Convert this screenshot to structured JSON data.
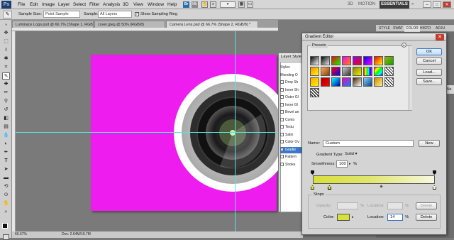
{
  "menu": {
    "logo": "Ps",
    "items": [
      "File",
      "Edit",
      "Image",
      "Layer",
      "Select",
      "Filter",
      "Analysis",
      "3D",
      "View",
      "Window",
      "Help"
    ],
    "workspaces": [
      "3D",
      "MOTION",
      "ESSENTIALS"
    ],
    "win_buttons": [
      "–",
      "□",
      "✕"
    ]
  },
  "options": {
    "sample_size_label": "Sample Size:",
    "sample_size_value": "Point Sample",
    "sample_label": "Sample:",
    "sample_value": "All Layers",
    "show_ring_label": "Show Sampling Ring",
    "show_ring_checked": true
  },
  "doc_tabs": [
    {
      "label": "Luminace Logo.psd @ 66.7% (Shape 1, RGB/8)",
      "active": false
    },
    {
      "label": "cover.jpeg @ 50% (RGB/8)",
      "active": false
    },
    {
      "label": "Camera Lens.psd @ 66.7% (Shape 2, RGB/8) *",
      "active": true
    }
  ],
  "layer_style": {
    "title": "Layer Style",
    "rows": [
      {
        "label": "Styles",
        "cb": false
      },
      {
        "label": "Blending O",
        "cb": false
      },
      {
        "label": "Drop Sh",
        "cb": true,
        "checked": false
      },
      {
        "label": "Inner Sh",
        "cb": true,
        "checked": false
      },
      {
        "label": "Outer Gl",
        "cb": true,
        "checked": false
      },
      {
        "label": "Inner Gl",
        "cb": true,
        "checked": false
      },
      {
        "label": "Bevel an",
        "cb": true,
        "checked": false
      },
      {
        "label": "Conto",
        "cb": true,
        "checked": false
      },
      {
        "label": "Textu",
        "cb": true,
        "checked": false
      },
      {
        "label": "Satin",
        "cb": true,
        "checked": false
      },
      {
        "label": "Color Ov",
        "cb": true,
        "checked": false
      },
      {
        "label": "Gradie",
        "cb": true,
        "checked": true
      },
      {
        "label": "Pattern",
        "cb": true,
        "checked": false
      },
      {
        "label": "Stroke",
        "cb": true,
        "checked": false
      }
    ]
  },
  "status": {
    "zoom": "66.67%",
    "doc": "Doc: 2.64M/10.7M"
  },
  "panel_tabs": [
    "STYLE",
    "SWAT",
    "COLOR",
    "HISTO",
    "ADJU"
  ],
  "panel_side_label": "Ne",
  "gradient_editor": {
    "title": "Gradient Editor",
    "presets_label": "Presets",
    "buttons": {
      "ok": "OK",
      "cancel": "Cancel",
      "load": "Load...",
      "save": "Save...",
      "new": "New",
      "delete1": "Delete",
      "delete2": "Delete"
    },
    "name_label": "Name:",
    "name_value": "Custom",
    "type_label": "Gradient Type:",
    "type_value": "Solid",
    "smooth_label": "Smoothness:",
    "smooth_value": "100",
    "smooth_unit": "%",
    "stops_label": "Stops",
    "opacity_label": "Opacity:",
    "opacity_unit": "%",
    "location_label": "Location:",
    "location_unit": "%",
    "color_label": "Color:",
    "color_location_value": "14",
    "color_swatch": "#d8e03a",
    "gradient_colors": [
      "#d8e03a",
      "#e0e66a",
      "#f6f8de"
    ],
    "presets": [
      [
        "#000000/#ffffff",
        "#000000/#ffffff00",
        "#ff0000/#00ff00",
        "#ff00ff/#ff8800",
        "#8800ff/#ff0000",
        "#0000ff/#ff00ff",
        "#ff0000/#ffff00",
        "#aaaa00/#00aa00"
      ],
      [
        "#ff8800/#ffff00",
        "#ffaa66/#884400",
        "#ff0000/#0000ff",
        "#cccccc/#333333",
        "#888800/#eeee00",
        "rainbow",
        "rainbow2",
        "check"
      ],
      [
        "#ffaa00/#ffee00",
        "#aa0000/#ff0000",
        "#00ffff/#0000aa",
        "#ff00aa/#0088ff",
        "#442200/#ffffff",
        "#88ccff/#004488",
        "#cc8800/#ffee88",
        "check2"
      ],
      [
        "stripe"
      ]
    ]
  }
}
